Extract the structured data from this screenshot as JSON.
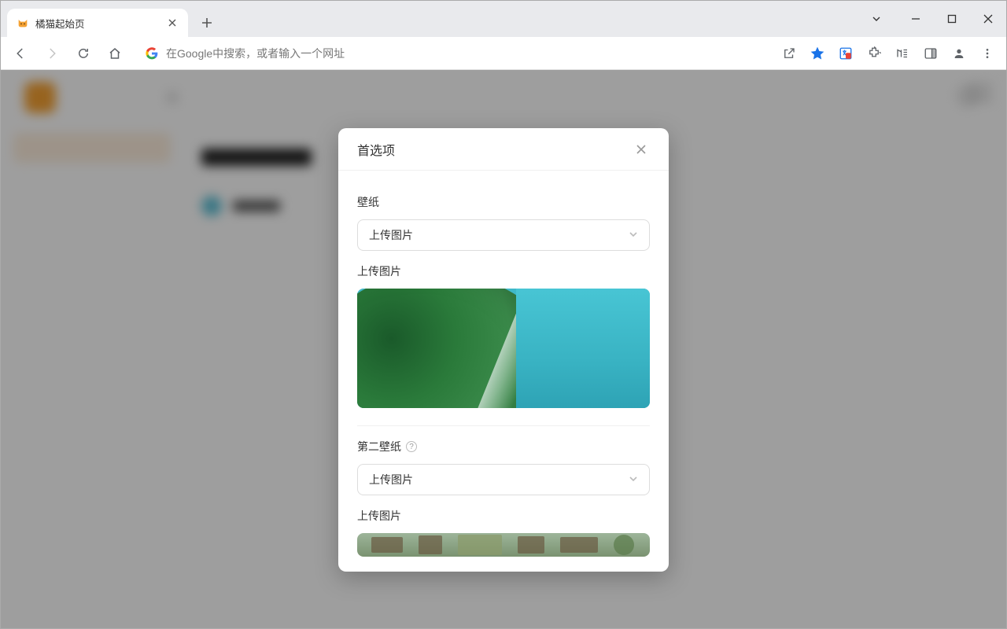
{
  "tab": {
    "title": "橘猫起始页"
  },
  "omnibox": {
    "placeholder": "在Google中搜索，或者输入一个网址"
  },
  "modal": {
    "title": "首选项",
    "section1": {
      "label": "壁纸",
      "select_value": "上传图片",
      "upload_label": "上传图片"
    },
    "section2": {
      "label": "第二壁纸",
      "select_value": "上传图片",
      "upload_label": "上传图片"
    }
  }
}
